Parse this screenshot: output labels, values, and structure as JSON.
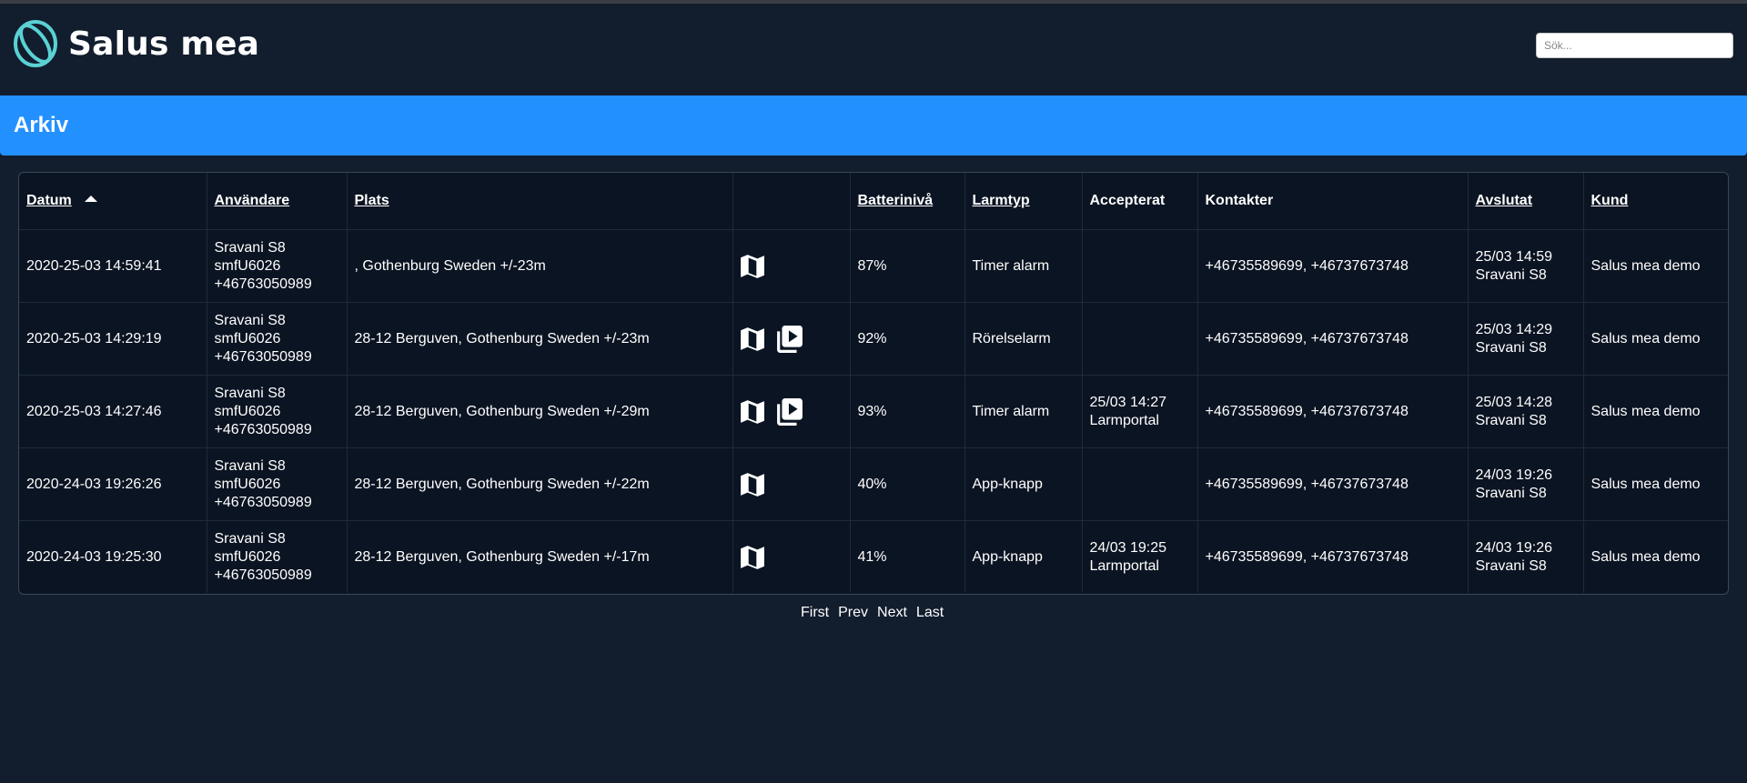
{
  "app": {
    "name": "Salus mea",
    "search_placeholder": "Sök..."
  },
  "page": {
    "title": "Arkiv"
  },
  "table": {
    "columns": {
      "datum": "Datum",
      "anvandare": "Användare",
      "plats": "Plats",
      "batteri": "Batterinivå",
      "larmtyp": "Larmtyp",
      "accepterat": "Accepterat",
      "kontakter": "Kontakter",
      "avslutat": "Avslutat",
      "kund": "Kund"
    },
    "sort": {
      "column": "Datum",
      "direction": "ascending"
    },
    "rows": [
      {
        "datum": "2020-25-03 14:59:41",
        "user_name": "Sravani S8",
        "user_id": "smfU6026",
        "user_phone": "+46763050989",
        "plats": ", Gothenburg Sweden +/-23m",
        "icons": [
          "map-icon"
        ],
        "batteri": "87%",
        "larmtyp": "Timer alarm",
        "accepterat_time": "",
        "accepterat_by": "",
        "kontakter": "+46735589699, +46737673748",
        "avslutat_time": "25/03 14:59",
        "avslutat_by": "Sravani S8",
        "kund": "Salus mea demo"
      },
      {
        "datum": "2020-25-03 14:29:19",
        "user_name": "Sravani S8",
        "user_id": "smfU6026",
        "user_phone": "+46763050989",
        "plats": "28-12 Berguven, Gothenburg Sweden +/-23m",
        "icons": [
          "map-icon",
          "video-library-icon"
        ],
        "batteri": "92%",
        "larmtyp": "Rörelselarm",
        "accepterat_time": "",
        "accepterat_by": "",
        "kontakter": "+46735589699, +46737673748",
        "avslutat_time": "25/03 14:29",
        "avslutat_by": "Sravani S8",
        "kund": "Salus mea demo"
      },
      {
        "datum": "2020-25-03 14:27:46",
        "user_name": "Sravani S8",
        "user_id": "smfU6026",
        "user_phone": "+46763050989",
        "plats": "28-12 Berguven, Gothenburg Sweden +/-29m",
        "icons": [
          "map-icon",
          "video-library-icon"
        ],
        "batteri": "93%",
        "larmtyp": "Timer alarm",
        "accepterat_time": "25/03 14:27",
        "accepterat_by": "Larmportal",
        "kontakter": "+46735589699, +46737673748",
        "avslutat_time": "25/03 14:28",
        "avslutat_by": "Sravani S8",
        "kund": "Salus mea demo"
      },
      {
        "datum": "2020-24-03 19:26:26",
        "user_name": "Sravani S8",
        "user_id": "smfU6026",
        "user_phone": "+46763050989",
        "plats": "28-12 Berguven, Gothenburg Sweden +/-22m",
        "icons": [
          "map-icon"
        ],
        "batteri": "40%",
        "larmtyp": "App-knapp",
        "accepterat_time": "",
        "accepterat_by": "",
        "kontakter": "+46735589699, +46737673748",
        "avslutat_time": "24/03 19:26",
        "avslutat_by": "Sravani S8",
        "kund": "Salus mea demo"
      },
      {
        "datum": "2020-24-03 19:25:30",
        "user_name": "Sravani S8",
        "user_id": "smfU6026",
        "user_phone": "+46763050989",
        "plats": "28-12 Berguven, Gothenburg Sweden +/-17m",
        "icons": [
          "map-icon"
        ],
        "batteri": "41%",
        "larmtyp": "App-knapp",
        "accepterat_time": "24/03 19:25",
        "accepterat_by": "Larmportal",
        "kontakter": "+46735589699, +46737673748",
        "avslutat_time": "24/03 19:26",
        "avslutat_by": "Sravani S8",
        "kund": "Salus mea demo"
      }
    ]
  },
  "pager": {
    "first": "First",
    "prev": "Prev",
    "next": "Next",
    "last": "Last"
  },
  "colors": {
    "background": "#121d2d",
    "banner": "#2390ff",
    "table_bg": "#0b1422",
    "logo_accent": "#5ad1d4"
  }
}
